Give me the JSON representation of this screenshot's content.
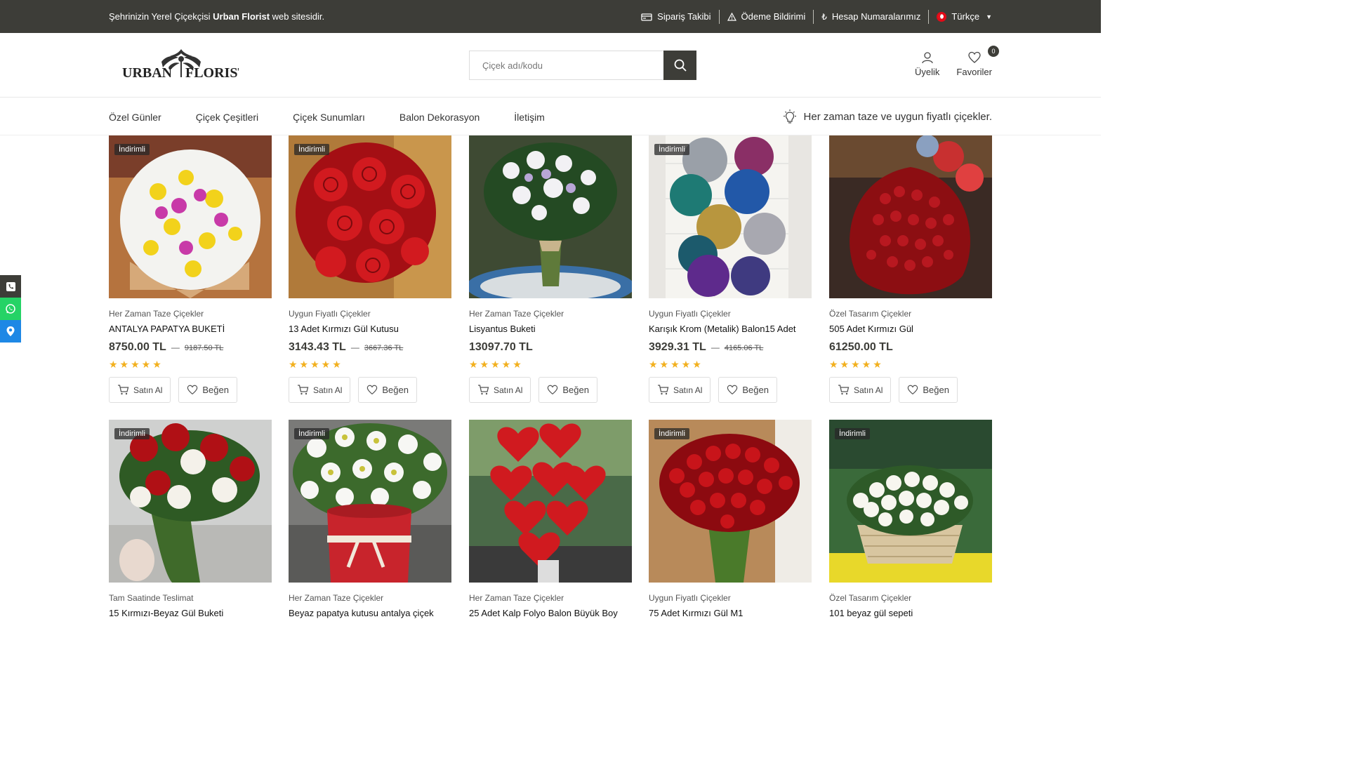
{
  "topbar": {
    "tagline_pre": "Şehrinizin Yerel Çiçekçisi ",
    "tagline_brand": "Urban Florist",
    "tagline_post": " web sitesidir.",
    "links": {
      "order_tracking": "Sipariş Takibi",
      "payment": "Ödeme Bildirimi",
      "accounts": "Hesap Numaralarımız",
      "language": "Türkçe"
    }
  },
  "header": {
    "logo_text": "URBAN FLORIST",
    "search_placeholder": "Çiçek adı/kodu",
    "account_label": "Üyelik",
    "favorites_label": "Favoriler",
    "favorites_count": "0"
  },
  "nav": {
    "items": [
      "Özel Günler",
      "Çiçek Çeşitleri",
      "Çiçek Sunumları",
      "Balon Dekorasyon",
      "İletişim"
    ],
    "promo": "Her zaman taze ve uygun fiyatlı çiçekler."
  },
  "labels": {
    "badge": "İndirimli",
    "buy": "Satın Al",
    "like": "Beğen",
    "stars": "★★★★★"
  },
  "colors": {
    "dark": "#3d3d38",
    "star": "#f2b01e",
    "whatsapp": "#25d366",
    "location": "#1e88e5"
  },
  "products": [
    {
      "category": "Her Zaman Taze Çiçekler",
      "name": "ANTALYA PAPATYA BUKETİ",
      "price": "8750.00 TL",
      "old_price": "9187.50 TL",
      "discount": true
    },
    {
      "category": "Uygun Fiyatlı Çiçekler",
      "name": "13 Adet Kırmızı Gül Kutusu",
      "price": "3143.43 TL",
      "old_price": "3667.36 TL",
      "discount": true
    },
    {
      "category": "Her Zaman Taze Çiçekler",
      "name": "Lisyantus Buketi",
      "price": "13097.70 TL",
      "old_price": "",
      "discount": false
    },
    {
      "category": "Uygun Fiyatlı Çiçekler",
      "name": "Karışık Krom (Metalik) Balon15 Adet",
      "price": "3929.31 TL",
      "old_price": "4165.06 TL",
      "discount": true
    },
    {
      "category": "Özel Tasarım Çiçekler",
      "name": "505 Adet Kırmızı Gül",
      "price": "61250.00 TL",
      "old_price": "",
      "discount": false
    },
    {
      "category": "Tam Saatinde Teslimat",
      "name": "15 Kırmızı-Beyaz Gül Buketi",
      "discount": true
    },
    {
      "category": "Her Zaman Taze Çiçekler",
      "name": "Beyaz papatya kutusu antalya çiçek",
      "discount": true
    },
    {
      "category": "Her Zaman Taze Çiçekler",
      "name": "25 Adet Kalp Folyo Balon Büyük Boy",
      "discount": false
    },
    {
      "category": "Uygun Fiyatlı Çiçekler",
      "name": "75 Adet Kırmızı Gül M1",
      "discount": true
    },
    {
      "category": "Özel Tasarım Çiçekler",
      "name": "101 beyaz gül sepeti",
      "discount": true
    }
  ]
}
